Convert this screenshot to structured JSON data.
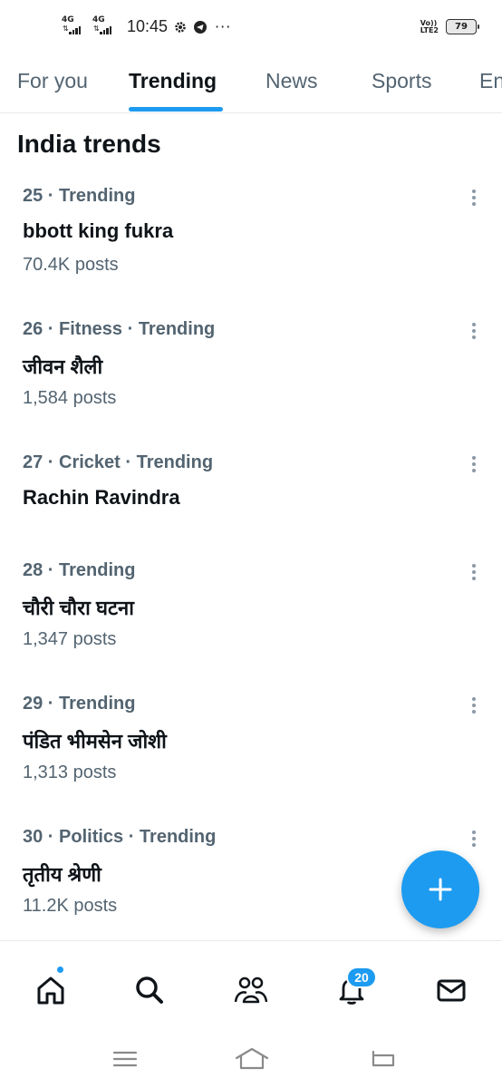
{
  "status_bar": {
    "network1": "4G",
    "network2": "4G",
    "time": "10:45",
    "volte": [
      "Vo))",
      "LTE2"
    ],
    "battery": "79"
  },
  "tabs": [
    {
      "label": "For you"
    },
    {
      "label": "Trending",
      "active": true
    },
    {
      "label": "News"
    },
    {
      "label": "Sports"
    },
    {
      "label": "En"
    }
  ],
  "section_title": "India trends",
  "trends": [
    {
      "meta": "25 · Trending",
      "name": "bbott king fukra",
      "posts": "70.4K posts"
    },
    {
      "meta": "26 · Fitness · Trending",
      "name": "जीवन शैली",
      "posts": "1,584 posts"
    },
    {
      "meta": "27 · Cricket · Trending",
      "name": "Rachin Ravindra",
      "posts": ""
    },
    {
      "meta": "28 · Trending",
      "name": "चौरी चौरा घटना",
      "posts": "1,347 posts"
    },
    {
      "meta": "29 · Trending",
      "name": "पंडित भीमसेन जोशी",
      "posts": "1,313 posts"
    },
    {
      "meta": "30 · Politics · Trending",
      "name": "तृतीय श्रेणी",
      "posts": "11.2K posts"
    }
  ],
  "fab": {
    "icon": "plus-icon"
  },
  "bottom_nav": {
    "items": [
      "home-icon",
      "search-icon",
      "communities-icon",
      "notifications-icon",
      "messages-icon"
    ],
    "notifications_badge": "20"
  },
  "system_nav": [
    "menu-icon",
    "home-outline-icon",
    "back-icon"
  ],
  "colors": {
    "accent": "#1d9bf0",
    "text": "#0f1419",
    "secondary": "#536471"
  }
}
